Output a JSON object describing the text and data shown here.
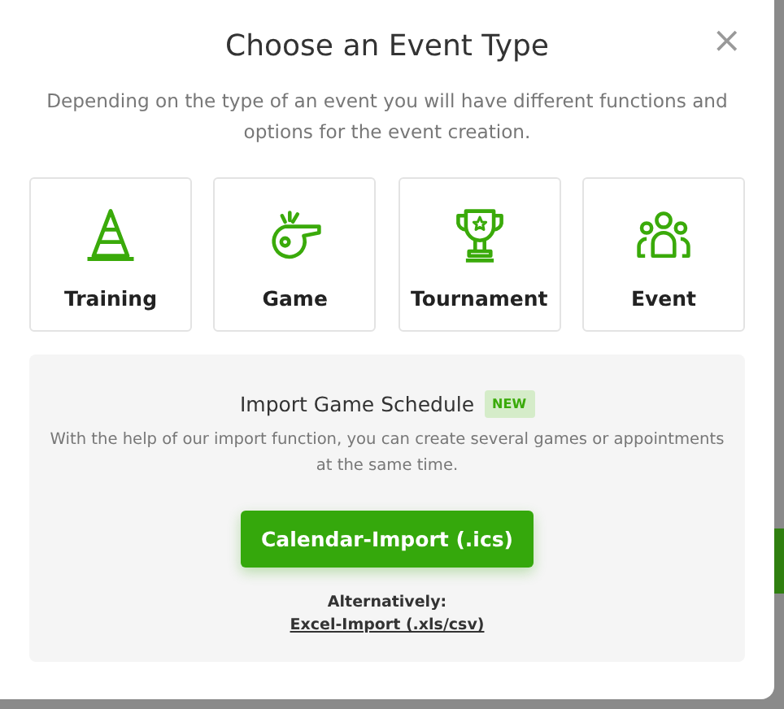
{
  "dialog": {
    "title": "Choose an Event Type",
    "close": "×",
    "description": "Depending on the type of an event you will have different functions and options for the event creation."
  },
  "event_types": [
    {
      "label": "Training",
      "kind": "cone"
    },
    {
      "label": "Game",
      "kind": "whistle"
    },
    {
      "label": "Tournament",
      "kind": "trophy"
    },
    {
      "label": "Event",
      "kind": "people"
    }
  ],
  "import": {
    "title": "Import Game Schedule",
    "badge": "NEW",
    "description": "With the help of our import function, you can create several games or appointments at the same time.",
    "button": "Calendar-Import (.ics)",
    "alternative_label": "Alternatively:",
    "alternative_link": "Excel-Import (.xls/csv)"
  }
}
